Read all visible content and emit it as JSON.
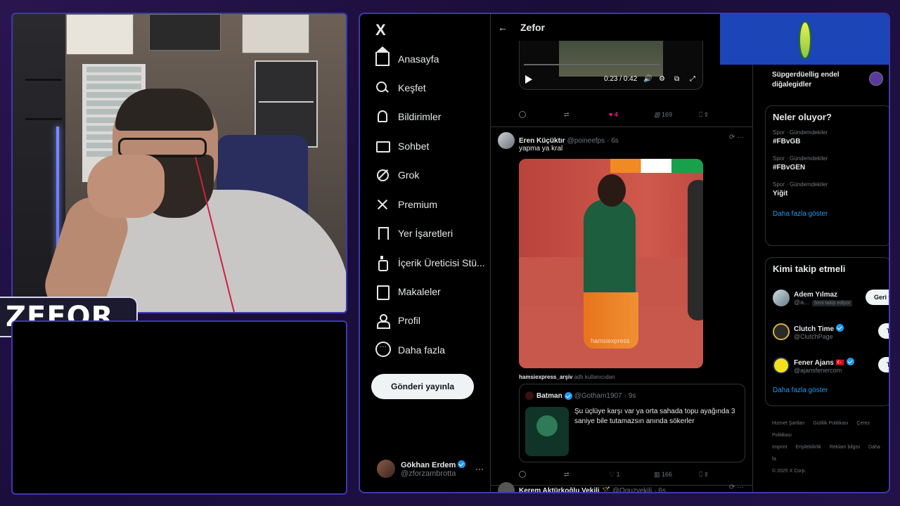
{
  "streamer": {
    "name_tag": "ZEFOR"
  },
  "nav": {
    "logo": "X",
    "items": [
      {
        "label": "Anasayfa",
        "icon": "home-icon"
      },
      {
        "label": "Keşfet",
        "icon": "search-icon"
      },
      {
        "label": "Bildirimler",
        "icon": "bell-icon"
      },
      {
        "label": "Sohbet",
        "icon": "mail-icon"
      },
      {
        "label": "Grok",
        "icon": "grok-icon"
      },
      {
        "label": "Premium",
        "icon": "x-icon"
      },
      {
        "label": "Yer İşaretleri",
        "icon": "bookmark-icon"
      },
      {
        "label": "İçerik Üreticisi Stü...",
        "icon": "creator-icon"
      },
      {
        "label": "Makaleler",
        "icon": "article-icon"
      },
      {
        "label": "Profil",
        "icon": "profile-icon"
      },
      {
        "label": "Daha fazla",
        "icon": "more-icon"
      }
    ],
    "post_button": "Gönderi yayınla",
    "account": {
      "name": "Gökhan Erdem",
      "handle": "@zforzambrotta",
      "menu": "···"
    }
  },
  "timeline": {
    "back": "←",
    "title": "Zefor",
    "video": {
      "time": "0:23 / 0:42"
    },
    "post1_actions": {
      "likes": "4",
      "views": "169"
    },
    "tweet": {
      "name": "Eren Küçüktır",
      "handle": "@poineefps",
      "age": "· 6s",
      "text": "yapma ya kral",
      "watermark": "hamsiexpress",
      "via_user": "hamsiexpress_arşiv",
      "via_suffix": "adlı kullanıcıdan",
      "quote": {
        "name": "Batman",
        "handle": "@Gotham1907",
        "age": "· 9s",
        "text": "Şu üçlüye karşı var ya orta sahada topu ayağında 3 saniye bile tutamazsın anında sökerler"
      },
      "actions": {
        "likes": "1",
        "views": "166"
      }
    },
    "next_tweet": {
      "name": "Kerem Aktürkoğlu Vekili 🪄",
      "handle": "@Oguzvekili",
      "age": "· 6s"
    }
  },
  "right": {
    "top_trend": "Süpgerdüellig endel\ndiğalegidler",
    "trends": {
      "title": "Neler oluyor?",
      "items": [
        {
          "category": "Spor · Gündemdekiler",
          "name": "#FBvGB"
        },
        {
          "category": "Spor · Gündemdekiler",
          "name": "#FBvGEN"
        },
        {
          "category": "Spor · Gündemdekiler",
          "name": "Yiğit"
        }
      ],
      "more": "Daha fazla göster"
    },
    "who_to_follow": {
      "title": "Kimi takip etmeli",
      "items": [
        {
          "name": "Adem Yılmaz",
          "handle": "@a...",
          "tag": "Seni takip ediyor",
          "button": "Geri ta"
        },
        {
          "name": "Clutch Time",
          "handle": "@ClutchPage",
          "button": "Ta"
        },
        {
          "name": "Fener Ajans 🇹🇷",
          "handle": "@ajansfenercom",
          "button": "Ta"
        }
      ],
      "more": "Daha fazla göster"
    },
    "footer": {
      "links": [
        "Hizmet Şartları",
        "Gizlilik Politikası",
        "Çerez Politikası",
        "Imprint",
        "Erişilebilirlik",
        "Reklam bilgisi",
        "Daha fa"
      ],
      "copyright": "© 2025 X Corp."
    }
  }
}
